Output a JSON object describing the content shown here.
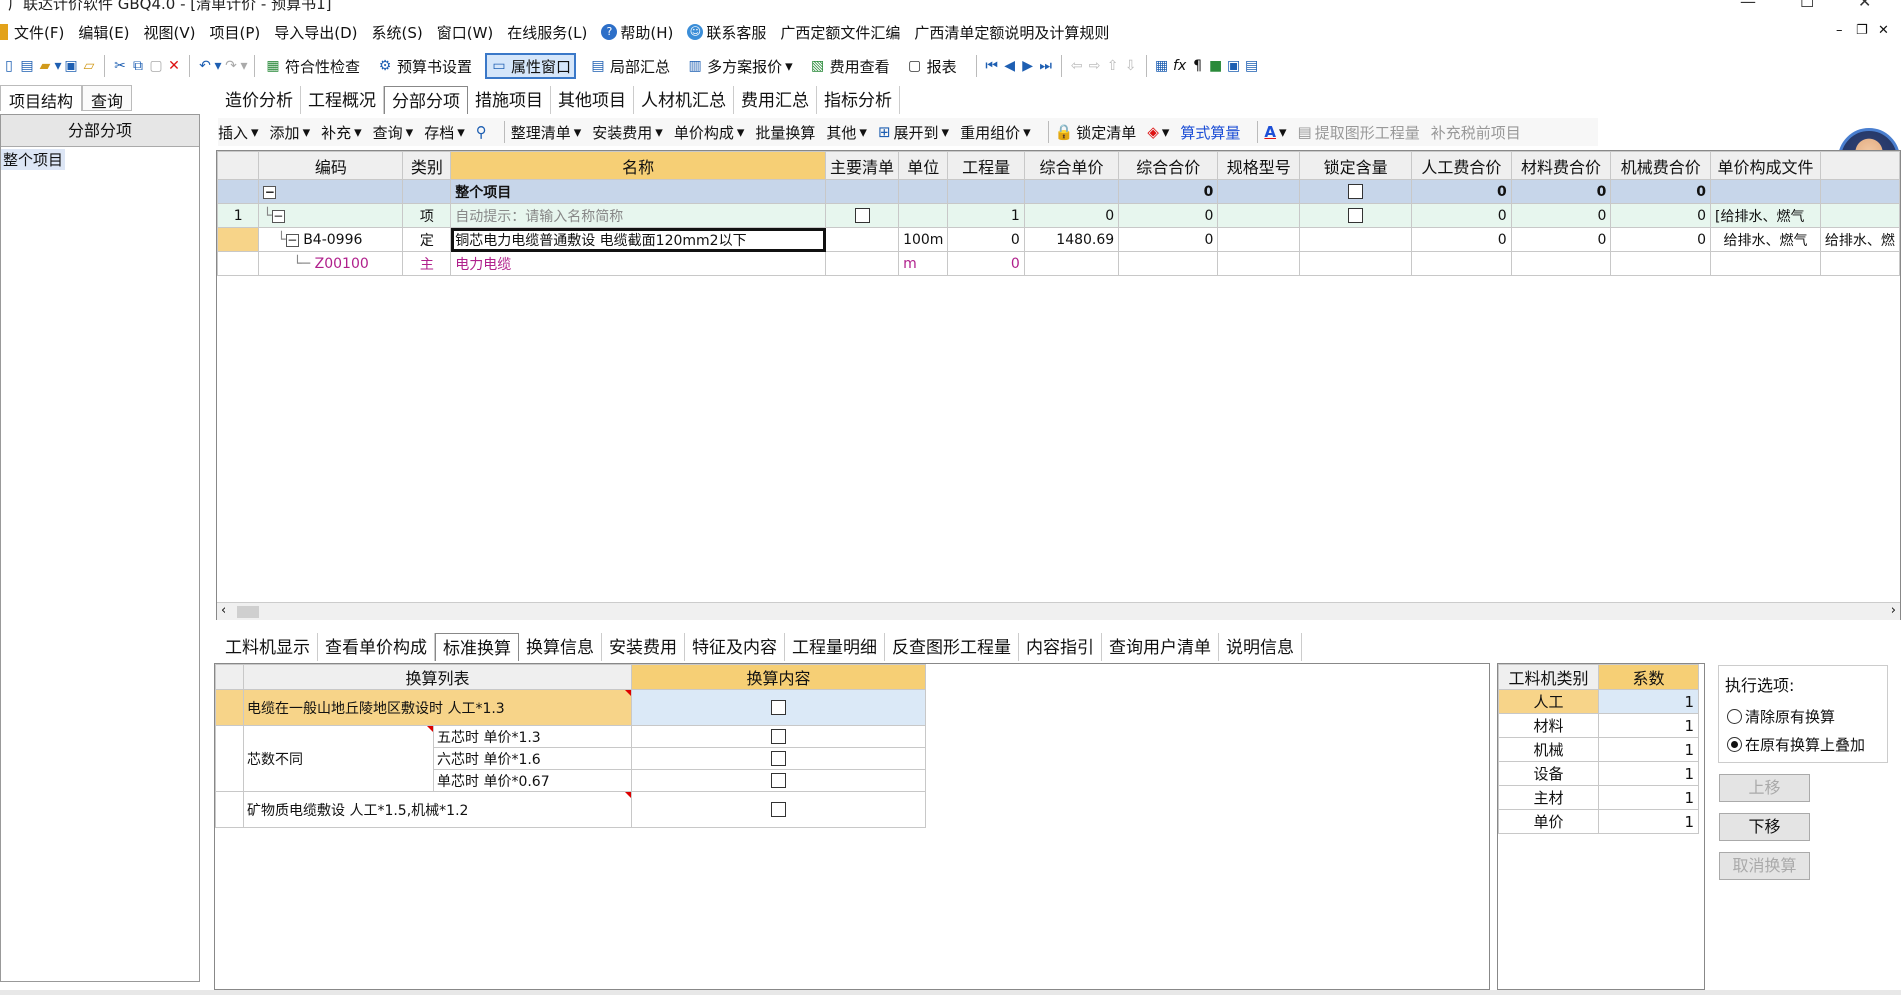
{
  "window": {
    "title": "广联达计价软件 GBQ4.0 - [清单计价 - 预算书1]"
  },
  "menu": [
    {
      "label": "文件(F)"
    },
    {
      "label": "编辑(E)"
    },
    {
      "label": "视图(V)"
    },
    {
      "label": "项目(P)"
    },
    {
      "label": "导入导出(D)"
    },
    {
      "label": "系统(S)"
    },
    {
      "label": "窗口(W)"
    },
    {
      "label": "在线服务(L)"
    },
    {
      "label": "帮助(H)",
      "icon": "help-icon"
    },
    {
      "label": "联系客服",
      "icon": "support-icon"
    },
    {
      "label": "广西定额文件汇编"
    },
    {
      "label": "广西清单定额说明及计算规则"
    }
  ],
  "toolbar": {
    "conformity_check": "符合性检查",
    "budget_settings": "预算书设置",
    "property_window": "属性窗口",
    "partial_summary": "局部汇总",
    "multi_quote": "多方案报价",
    "fee_view": "费用查看",
    "report": "报表"
  },
  "left": {
    "tabs": [
      "项目结构",
      "查询"
    ],
    "header": "分部分项",
    "item": "整个项目"
  },
  "main_tabs": [
    "造价分析",
    "工程概况",
    "分部分项",
    "措施项目",
    "其他项目",
    "人材机汇总",
    "费用汇总",
    "指标分析"
  ],
  "subbar": {
    "insert": "插入",
    "add": "添加",
    "supplement": "补充",
    "query": "查询",
    "save": "存档",
    "organize": "整理清单",
    "install_fee": "安装费用",
    "unit_price": "单价构成",
    "batch": "批量换算",
    "other": "其他",
    "expand": "展开到",
    "reuse": "重用组价",
    "lock": "锁定清单",
    "formula": "算式算量",
    "extract": "提取图形工程量",
    "pre_tax": "补充税前项目"
  },
  "grid": {
    "headers": [
      "编码",
      "类别",
      "名称",
      "主要清单",
      "单位",
      "工程量",
      "综合单价",
      "综合合价",
      "规格型号",
      "锁定含量",
      "人工费合价",
      "材料费合价",
      "机械费合价",
      "单价构成文件",
      ""
    ],
    "summary": {
      "name": "整个项目",
      "total": "0",
      "labor": "0",
      "material": "0",
      "machine": "0"
    },
    "row1": {
      "no": "1",
      "type": "项",
      "name": "自动提示：请输入名称简称",
      "qty": "1",
      "unit_price": "0",
      "total": "0",
      "labor": "0",
      "material": "0",
      "machine": "0",
      "file": "[给排水、燃气"
    },
    "row2": {
      "code": "B4-0996",
      "type": "定",
      "name": "铜芯电力电缆普通敷设 电缆截面120mm2以下",
      "unit": "100m",
      "qty": "0",
      "unit_price": "1480.69",
      "total": "0",
      "labor": "0",
      "material": "0",
      "machine": "0",
      "file": "给排水、燃气",
      "file2": "给排水、燃"
    },
    "row3": {
      "code": "Z00100",
      "type": "主",
      "name": "电力电缆",
      "unit": "m",
      "qty": "0"
    }
  },
  "bottom_tabs": [
    "工料机显示",
    "查看单价构成",
    "标准换算",
    "换算信息",
    "安装费用",
    "特征及内容",
    "工程量明细",
    "反查图形工程量",
    "内容指引",
    "查询用户清单",
    "说明信息"
  ],
  "conversion": {
    "headers": [
      "换算列表",
      "换算内容"
    ],
    "r1": "电缆在一般山地丘陵地区敷设时 人工*1.3",
    "group": "芯数不同",
    "g1": "五芯时 单价*1.3",
    "g2": "六芯时 单价*1.6",
    "g3": "单芯时 单价*0.67",
    "r5": "矿物质电缆敷设 人工*1.5,机械*1.2"
  },
  "coef": {
    "headers": [
      "工料机类别",
      "系数"
    ],
    "rows": [
      {
        "name": "人工",
        "value": "1"
      },
      {
        "name": "材料",
        "value": "1"
      },
      {
        "name": "机械",
        "value": "1"
      },
      {
        "name": "设备",
        "value": "1"
      },
      {
        "name": "主材",
        "value": "1"
      },
      {
        "name": "单价",
        "value": "1"
      }
    ]
  },
  "exec": {
    "legend": "执行选项:",
    "opt1": "清除原有换算",
    "opt2": "在原有换算上叠加",
    "selected": "opt2",
    "up": "上移",
    "down": "下移",
    "cancel": "取消换算"
  }
}
